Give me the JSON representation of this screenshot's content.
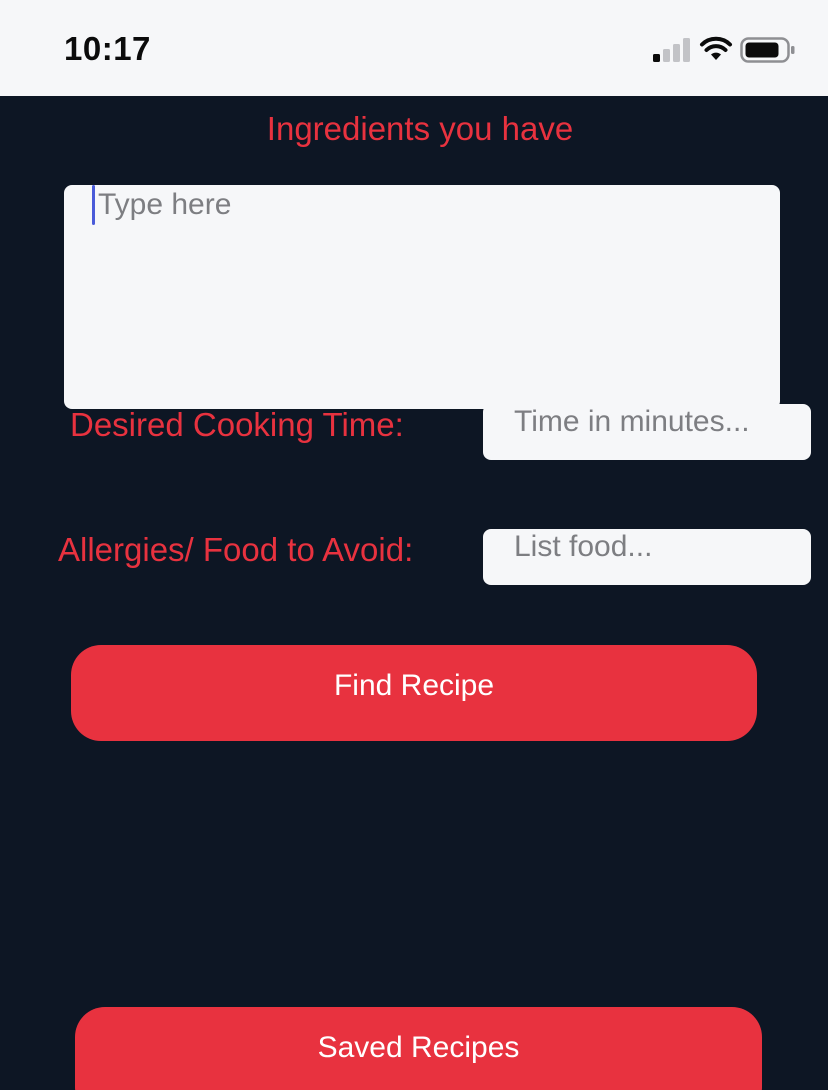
{
  "status_bar": {
    "time": "10:17",
    "icons": [
      "signal-icon",
      "wifi-icon",
      "battery-icon"
    ]
  },
  "form": {
    "ingredients_title": "Ingredients you have",
    "ingredients_placeholder": "Type here",
    "cooking_time_label": "Desired Cooking Time:",
    "cooking_time_placeholder": "Time in minutes...",
    "allergies_label": "Allergies/ Food to Avoid:",
    "allergies_placeholder": "List food...",
    "find_button_label": "Find Recipe",
    "saved_button_label": "Saved Recipes"
  },
  "colors": {
    "background": "#0d1624",
    "accent": "#e8323f",
    "input_bg": "#f6f7f9",
    "placeholder": "#7d7e82",
    "caret": "#4a5bd9"
  }
}
